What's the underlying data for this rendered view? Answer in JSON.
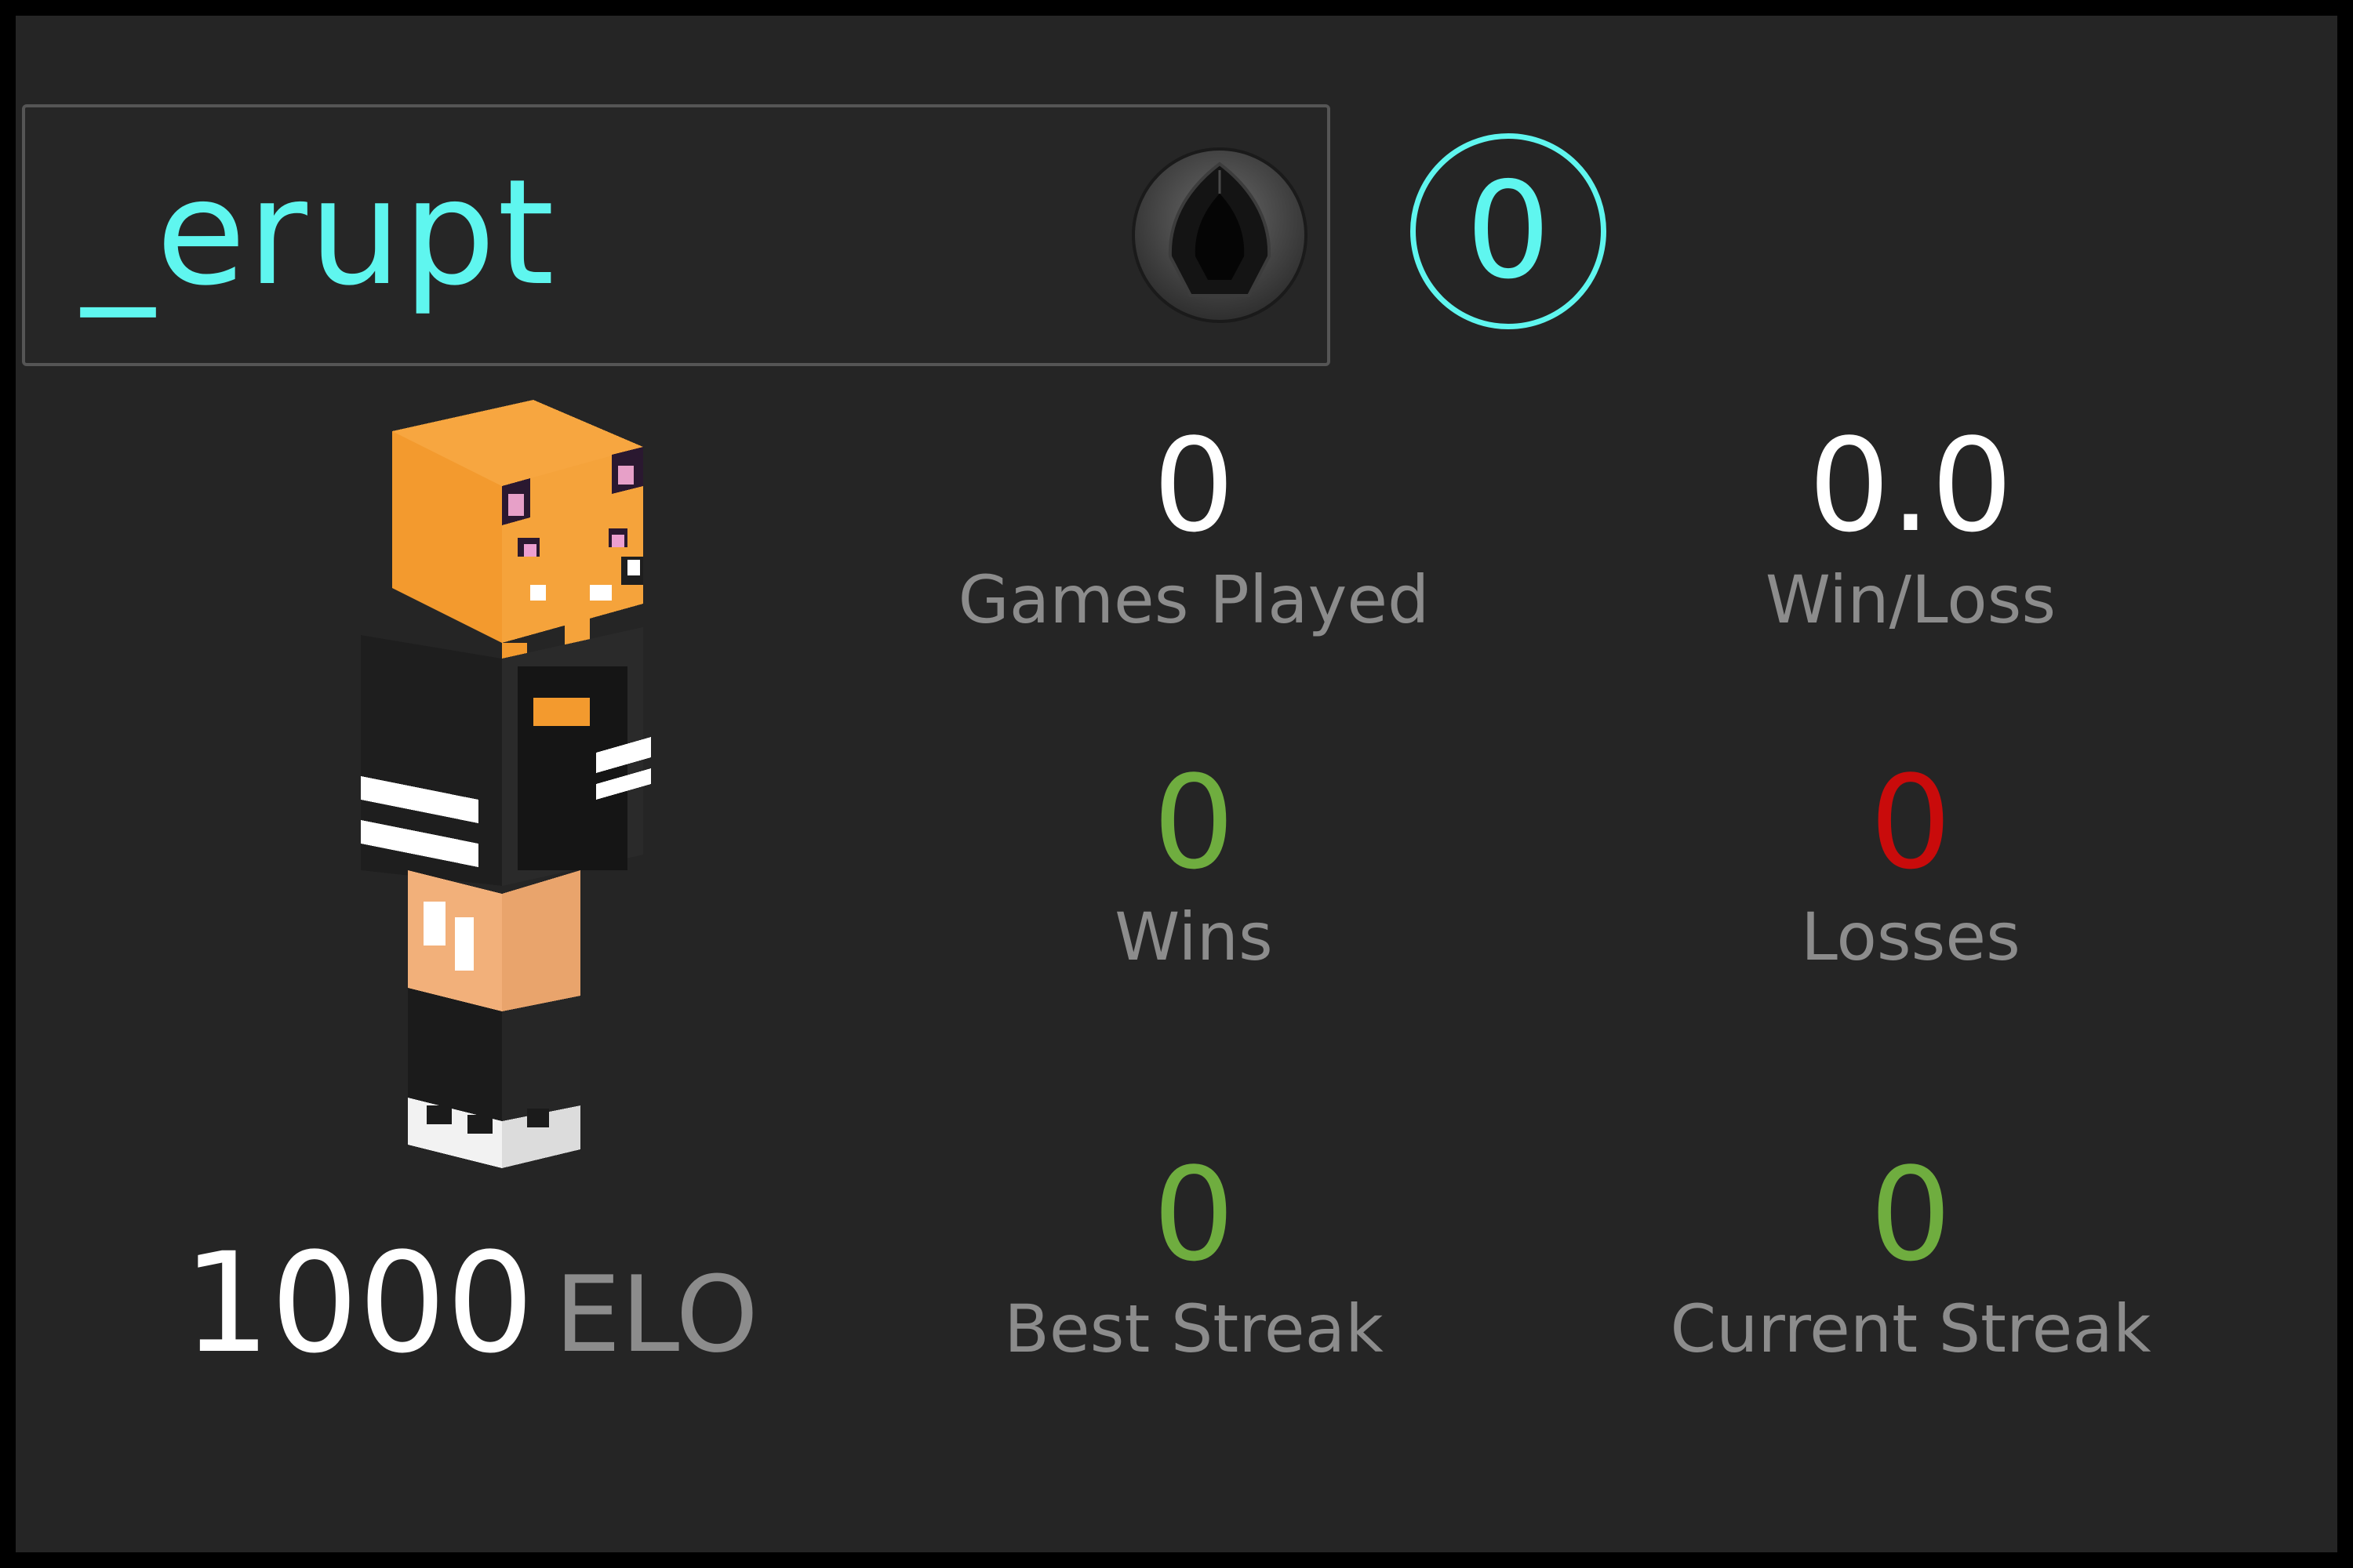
{
  "theme": {
    "accent": "#5ff6ef",
    "value_white": "#ffffff",
    "value_green": "#6fad3f",
    "value_red": "#c90b0b",
    "label_gray": "#8c8c8c"
  },
  "player": {
    "name": "_erupt",
    "rank_icon": "black-gem-rank-icon",
    "level": "0",
    "skin_icon": "minecraft-skin-avatar",
    "elo_value": "1000",
    "elo_label": "ELO"
  },
  "stats": [
    {
      "label": "Games Played",
      "value": "0",
      "color": "#ffffff"
    },
    {
      "label": "Win/Loss",
      "value": "0.0",
      "color": "#ffffff"
    },
    {
      "label": "Wins",
      "value": "0",
      "color": "#6fad3f"
    },
    {
      "label": "Losses",
      "value": "0",
      "color": "#c90b0b"
    },
    {
      "label": "Best Streak",
      "value": "0",
      "color": "#6fad3f"
    },
    {
      "label": "Current Streak",
      "value": "0",
      "color": "#6fad3f"
    }
  ]
}
